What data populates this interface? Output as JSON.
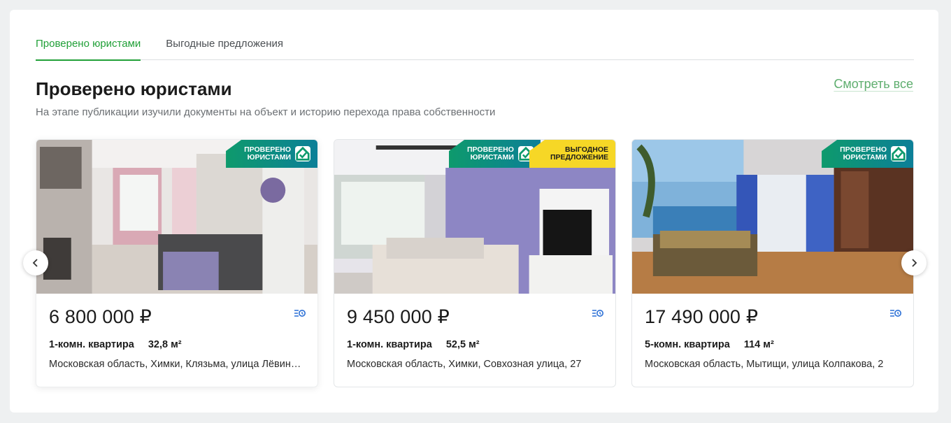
{
  "tabs": [
    {
      "label": "Проверено юристами",
      "active": true
    },
    {
      "label": "Выгодные предложения",
      "active": false
    }
  ],
  "section": {
    "title": "Проверено юристами",
    "subtitle": "На этапе публикации изучили документы на объект и историю перехода права собственности",
    "see_all": "Смотреть все"
  },
  "badges": {
    "verified_line1": "Проверено",
    "verified_line2": "юристами",
    "deal_line1": "Выгодное",
    "deal_line2": "предложение"
  },
  "listings": [
    {
      "price": "6 800 000 ₽",
      "rooms": "1-комн. квартира",
      "area": "32,8 м²",
      "address": "Московская область, Химки, Клязьма, улица Лёвинская",
      "badges": [
        "verified"
      ]
    },
    {
      "price": "9 450 000 ₽",
      "rooms": "1-комн. квартира",
      "area": "52,5 м²",
      "address": "Московская область, Химки, Совхозная улица, 27",
      "badges": [
        "verified",
        "deal"
      ]
    },
    {
      "price": "17 490 000 ₽",
      "rooms": "5-комн. квартира",
      "area": "114 м²",
      "address": "Московская область, Мытищи, улица Колпакова, 2",
      "badges": [
        "verified"
      ]
    }
  ],
  "icons": {
    "compare": "compare-icon",
    "prev": "chevron-left-icon",
    "next": "chevron-right-icon"
  },
  "colors": {
    "accent": "#21a038",
    "badge_verified": "#0e9a6c",
    "badge_deal": "#f6d726"
  }
}
